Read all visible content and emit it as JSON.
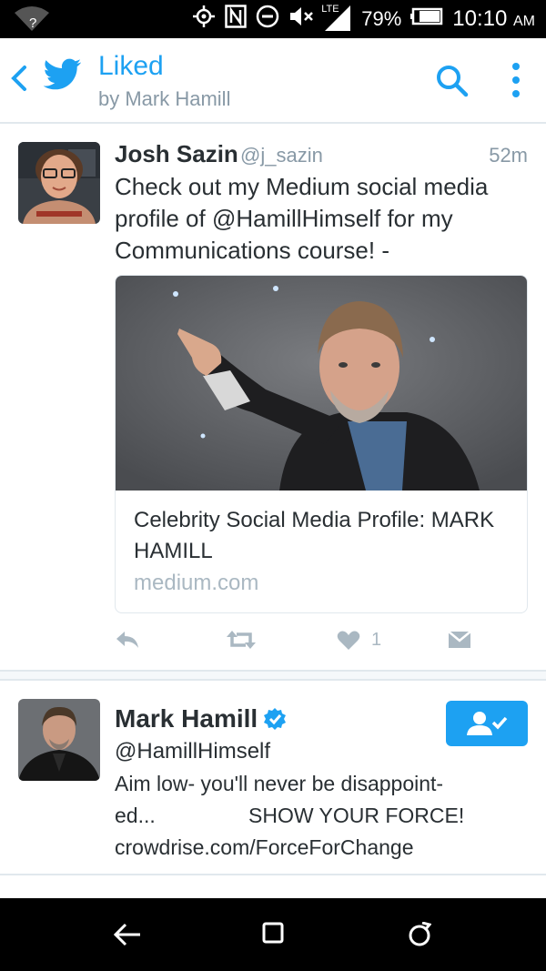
{
  "status_bar": {
    "network_badge": "?",
    "lte": "LTE",
    "battery": "79%",
    "time": "10:10",
    "ampm": "AM",
    "icons": [
      "wifi-icon",
      "location-icon",
      "nfc-icon",
      "do-not-disturb-icon",
      "mute-icon",
      "signal-icon",
      "battery-icon"
    ]
  },
  "header": {
    "title": "Liked",
    "subtitle": "by Mark Hamill"
  },
  "tweet": {
    "name": "Josh Sazin",
    "handle": "@j_sazin",
    "time": "52m",
    "text": "Check out my Medium social media profile of @HamillHimself for my Communications course! -",
    "card": {
      "title": "Celebrity Social Media Profile: MARK HAMILL",
      "domain": "medium.com"
    },
    "like_count": "1"
  },
  "user_card": {
    "name": "Mark Hamill",
    "handle": "@HamillHimself",
    "bio": "Aim low- you'll never be disappoint-\ned...                SHOW YOUR FORCE!\ncrowdrise.com/ForceForChange"
  },
  "colors": {
    "accent": "#1da1f2",
    "muted": "#8899a6",
    "text": "#292f33"
  }
}
